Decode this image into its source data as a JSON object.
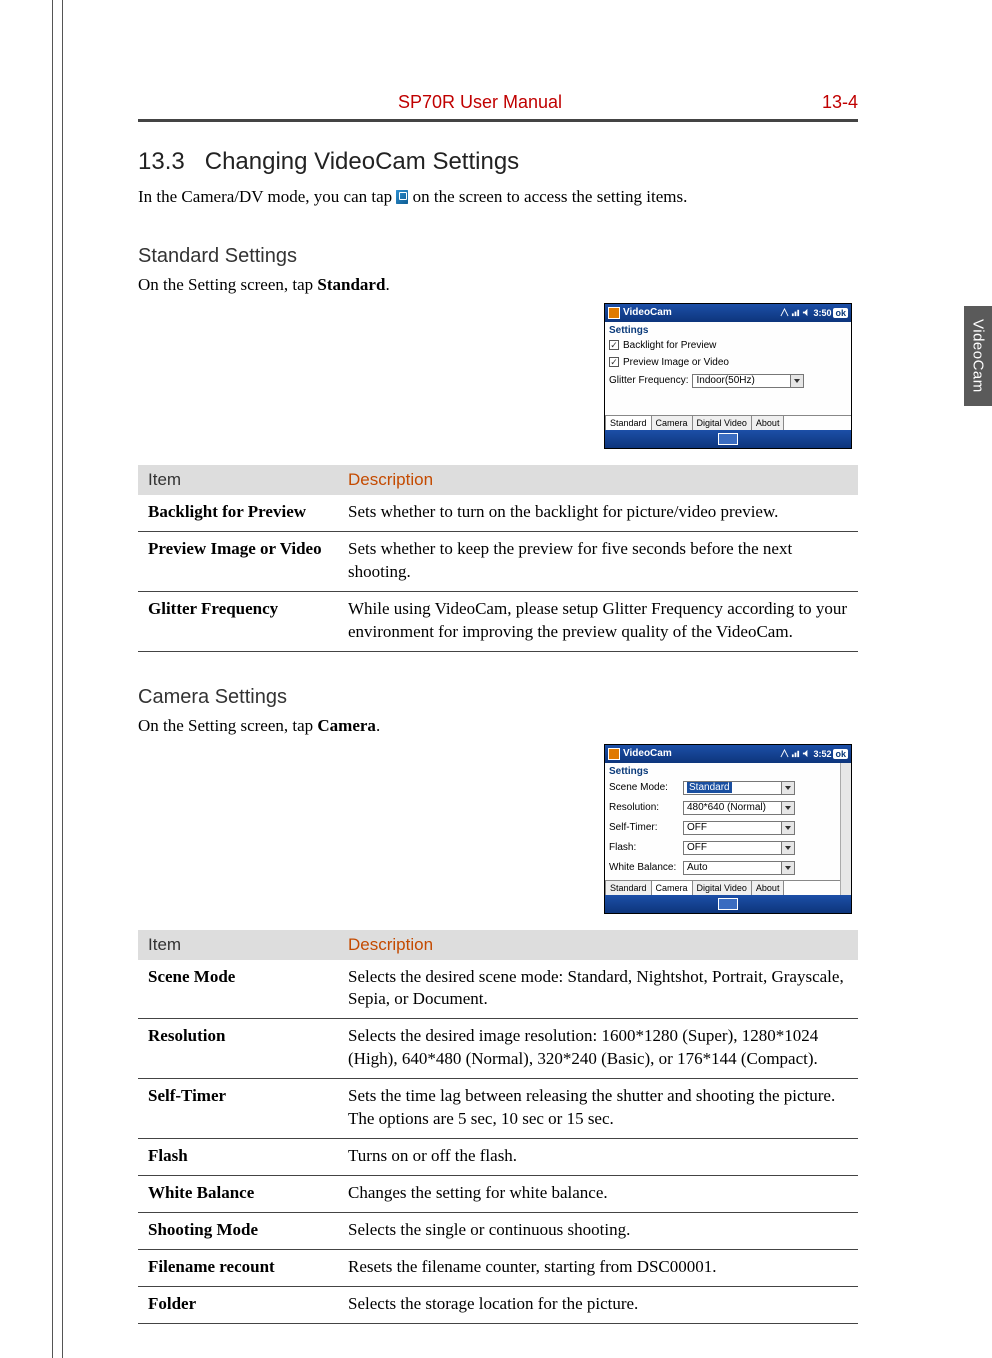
{
  "header": {
    "doc_title": "SP70R User Manual",
    "page_number": "13-4"
  },
  "section": {
    "number": "13.3",
    "title": "Changing VideoCam Settings"
  },
  "intro": {
    "pre": "In the Camera/DV mode, you can tap ",
    "post": " on the screen to access the setting items."
  },
  "side_tab": "VideoCam",
  "standard": {
    "title": "Standard Settings",
    "lead_pre": "On the Setting screen, tap ",
    "lead_bold": "Standard",
    "lead_post": "."
  },
  "camera": {
    "title": "Camera Settings",
    "lead_pre": "On the Setting screen, tap ",
    "lead_bold": "Camera",
    "lead_post": "."
  },
  "table_headers": {
    "item": "Item",
    "desc": "Description"
  },
  "standard_table": [
    {
      "item": "Backlight for Preview",
      "desc": "Sets whether to turn on the backlight for picture/video preview."
    },
    {
      "item": "Preview Image or Video",
      "desc": "Sets whether to keep the preview for five seconds before the next shooting."
    },
    {
      "item": "Glitter Frequency",
      "desc": "While using VideoCam, please setup Glitter Frequency according to your environment for improving the preview quality of the VideoCam."
    }
  ],
  "camera_table": [
    {
      "item": "Scene Mode",
      "desc": "Selects the desired scene mode: Standard, Nightshot, Portrait, Grayscale, Sepia, or Document."
    },
    {
      "item": "Resolution",
      "desc": "Selects the desired image resolution: 1600*1280 (Super), 1280*1024 (High), 640*480 (Normal), 320*240 (Basic), or 176*144 (Compact)."
    },
    {
      "item": "Self-Timer",
      "desc": "Sets the time lag between releasing the shutter and shooting the picture. The options are 5 sec, 10 sec or 15 sec."
    },
    {
      "item": "Flash",
      "desc": "Turns on or off the flash."
    },
    {
      "item": "White Balance",
      "desc": "Changes the setting for white balance."
    },
    {
      "item": "Shooting Mode",
      "desc": "Selects the single or continuous shooting."
    },
    {
      "item": "Filename recount",
      "desc": "Resets the filename counter, starting from DSC00001."
    },
    {
      "item": "Folder",
      "desc": "Selects the storage location for the picture."
    }
  ],
  "shot_common": {
    "window_title": "VideoCam",
    "settings_label": "Settings",
    "ok": "ok",
    "tabs": [
      "Standard",
      "Camera",
      "Digital Video",
      "About"
    ]
  },
  "shot_standard": {
    "time": "3:50",
    "checkbox1": "Backlight for Preview",
    "checkbox2": "Preview Image or Video",
    "glitter_label": "Glitter Frequency:",
    "glitter_value": "Indoor(50Hz)",
    "active_tab": 0
  },
  "shot_camera": {
    "time": "3:52",
    "fields": [
      {
        "label": "Scene Mode:",
        "value": "Standard",
        "hl": true
      },
      {
        "label": "Resolution:",
        "value": "480*640 (Normal)",
        "hl": false
      },
      {
        "label": "Self-Timer:",
        "value": "OFF",
        "hl": false
      },
      {
        "label": "Flash:",
        "value": "OFF",
        "hl": false
      },
      {
        "label": "White Balance:",
        "value": "Auto",
        "hl": false
      }
    ],
    "active_tab": 1
  }
}
